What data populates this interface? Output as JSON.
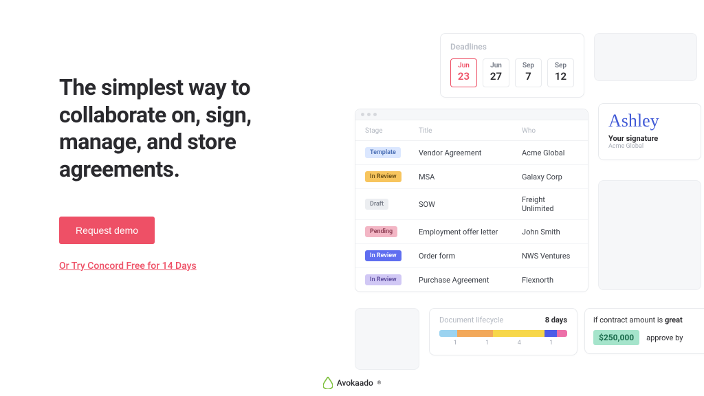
{
  "headline": "The simplest way to collaborate on, sign, manage, and store agreements.",
  "cta": {
    "demo": "Request demo",
    "trial": "Or Try Concord Free for 14 Days"
  },
  "deadlines": {
    "title": "Deadlines",
    "dates": [
      {
        "mon": "Jun",
        "day": "23",
        "active": true
      },
      {
        "mon": "Jun",
        "day": "27",
        "active": false
      },
      {
        "mon": "Sep",
        "day": "7",
        "active": false
      },
      {
        "mon": "Sep",
        "day": "12",
        "active": false
      }
    ]
  },
  "doctable": {
    "cols": {
      "stage": "Stage",
      "title": "Title",
      "who": "Who"
    },
    "rows": [
      {
        "tag": "Template",
        "cls": "tag-template",
        "title": "Vendor Agreement",
        "who": "Acme Global"
      },
      {
        "tag": "In Review",
        "cls": "tag-inreview1",
        "title": "MSA",
        "who": "Galaxy Corp"
      },
      {
        "tag": "Draft",
        "cls": "tag-draft",
        "title": "SOW",
        "who": "Freight Unlimited"
      },
      {
        "tag": "Pending",
        "cls": "tag-pending",
        "title": "Employment offer letter",
        "who": "John Smith"
      },
      {
        "tag": "In Review",
        "cls": "tag-inreview2",
        "title": "Order form",
        "who": "NWS Ventures"
      },
      {
        "tag": "In Review",
        "cls": "tag-inreview3",
        "title": "Purchase Agreement",
        "who": "Flexnorth"
      }
    ]
  },
  "signature": {
    "script": "Ashley",
    "label": "Your signature",
    "sub": "Acme Global"
  },
  "lifecycle": {
    "title": "Document lifecycle",
    "days": "8 days",
    "nums": [
      "1",
      "1",
      "4",
      "1"
    ]
  },
  "rule": {
    "line1_a": "if contract amount is ",
    "line1_b": "great",
    "amount": "$250,000",
    "approve": "approve by"
  },
  "footer": "Avokaado"
}
